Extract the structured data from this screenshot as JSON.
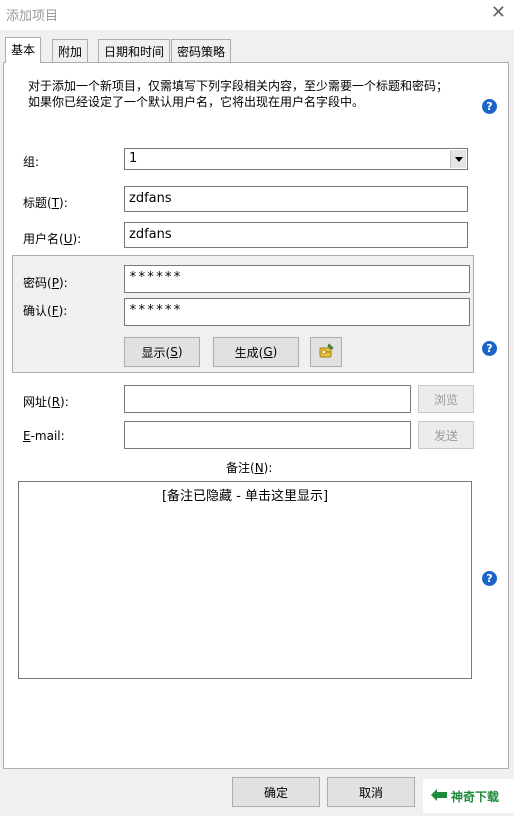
{
  "window": {
    "title": "添加项目",
    "close_icon": "close-icon"
  },
  "tabs": [
    {
      "label": "基本",
      "active": true
    },
    {
      "label": "附加",
      "active": false
    },
    {
      "label": "日期和时间",
      "active": false
    },
    {
      "label": "密码策略",
      "active": false
    }
  ],
  "intro": {
    "line1": "对于添加一个新项目，仅需填写下列字段相关内容，至少需要一个标题和密码；",
    "line2": "如果你已经设定了一个默认用户名，它将出现在用户名字段中。"
  },
  "fields": {
    "group": {
      "label": "组:",
      "value": "1"
    },
    "title": {
      "label_pre": "标题(",
      "key": "T",
      "label_post": "):",
      "value": "zdfans"
    },
    "username": {
      "label_pre": "用户名(",
      "key": "U",
      "label_post": "):",
      "value": "zdfans"
    },
    "password": {
      "label_pre": "密码(",
      "key": "P",
      "label_post": "):",
      "value": "******"
    },
    "confirm": {
      "label_pre": "确认(",
      "key": "F",
      "label_post": "):",
      "value": "******"
    },
    "url": {
      "label_pre": "网址(",
      "key": "R",
      "label_post": "):",
      "value": ""
    },
    "email": {
      "key": "E",
      "label_post": "-mail:",
      "value": ""
    },
    "notes": {
      "label_pre": "备注(",
      "key": "N",
      "label_post": "):",
      "hidden_text": "[备注已隐藏 - 单击这里显示]"
    }
  },
  "buttons": {
    "show": {
      "label_pre": "显示(",
      "key": "S",
      "label_post": ")"
    },
    "generate": {
      "label_pre": "生成(",
      "key": "G",
      "label_post": ")"
    },
    "browse": "浏览",
    "send": "发送",
    "ok": "确定",
    "cancel": "取消"
  },
  "help_icon": "?",
  "watermark": {
    "text": "神奇下载"
  },
  "colors": {
    "help_blue": "#1b65c9",
    "watermark_green": "#1e8b3a"
  }
}
